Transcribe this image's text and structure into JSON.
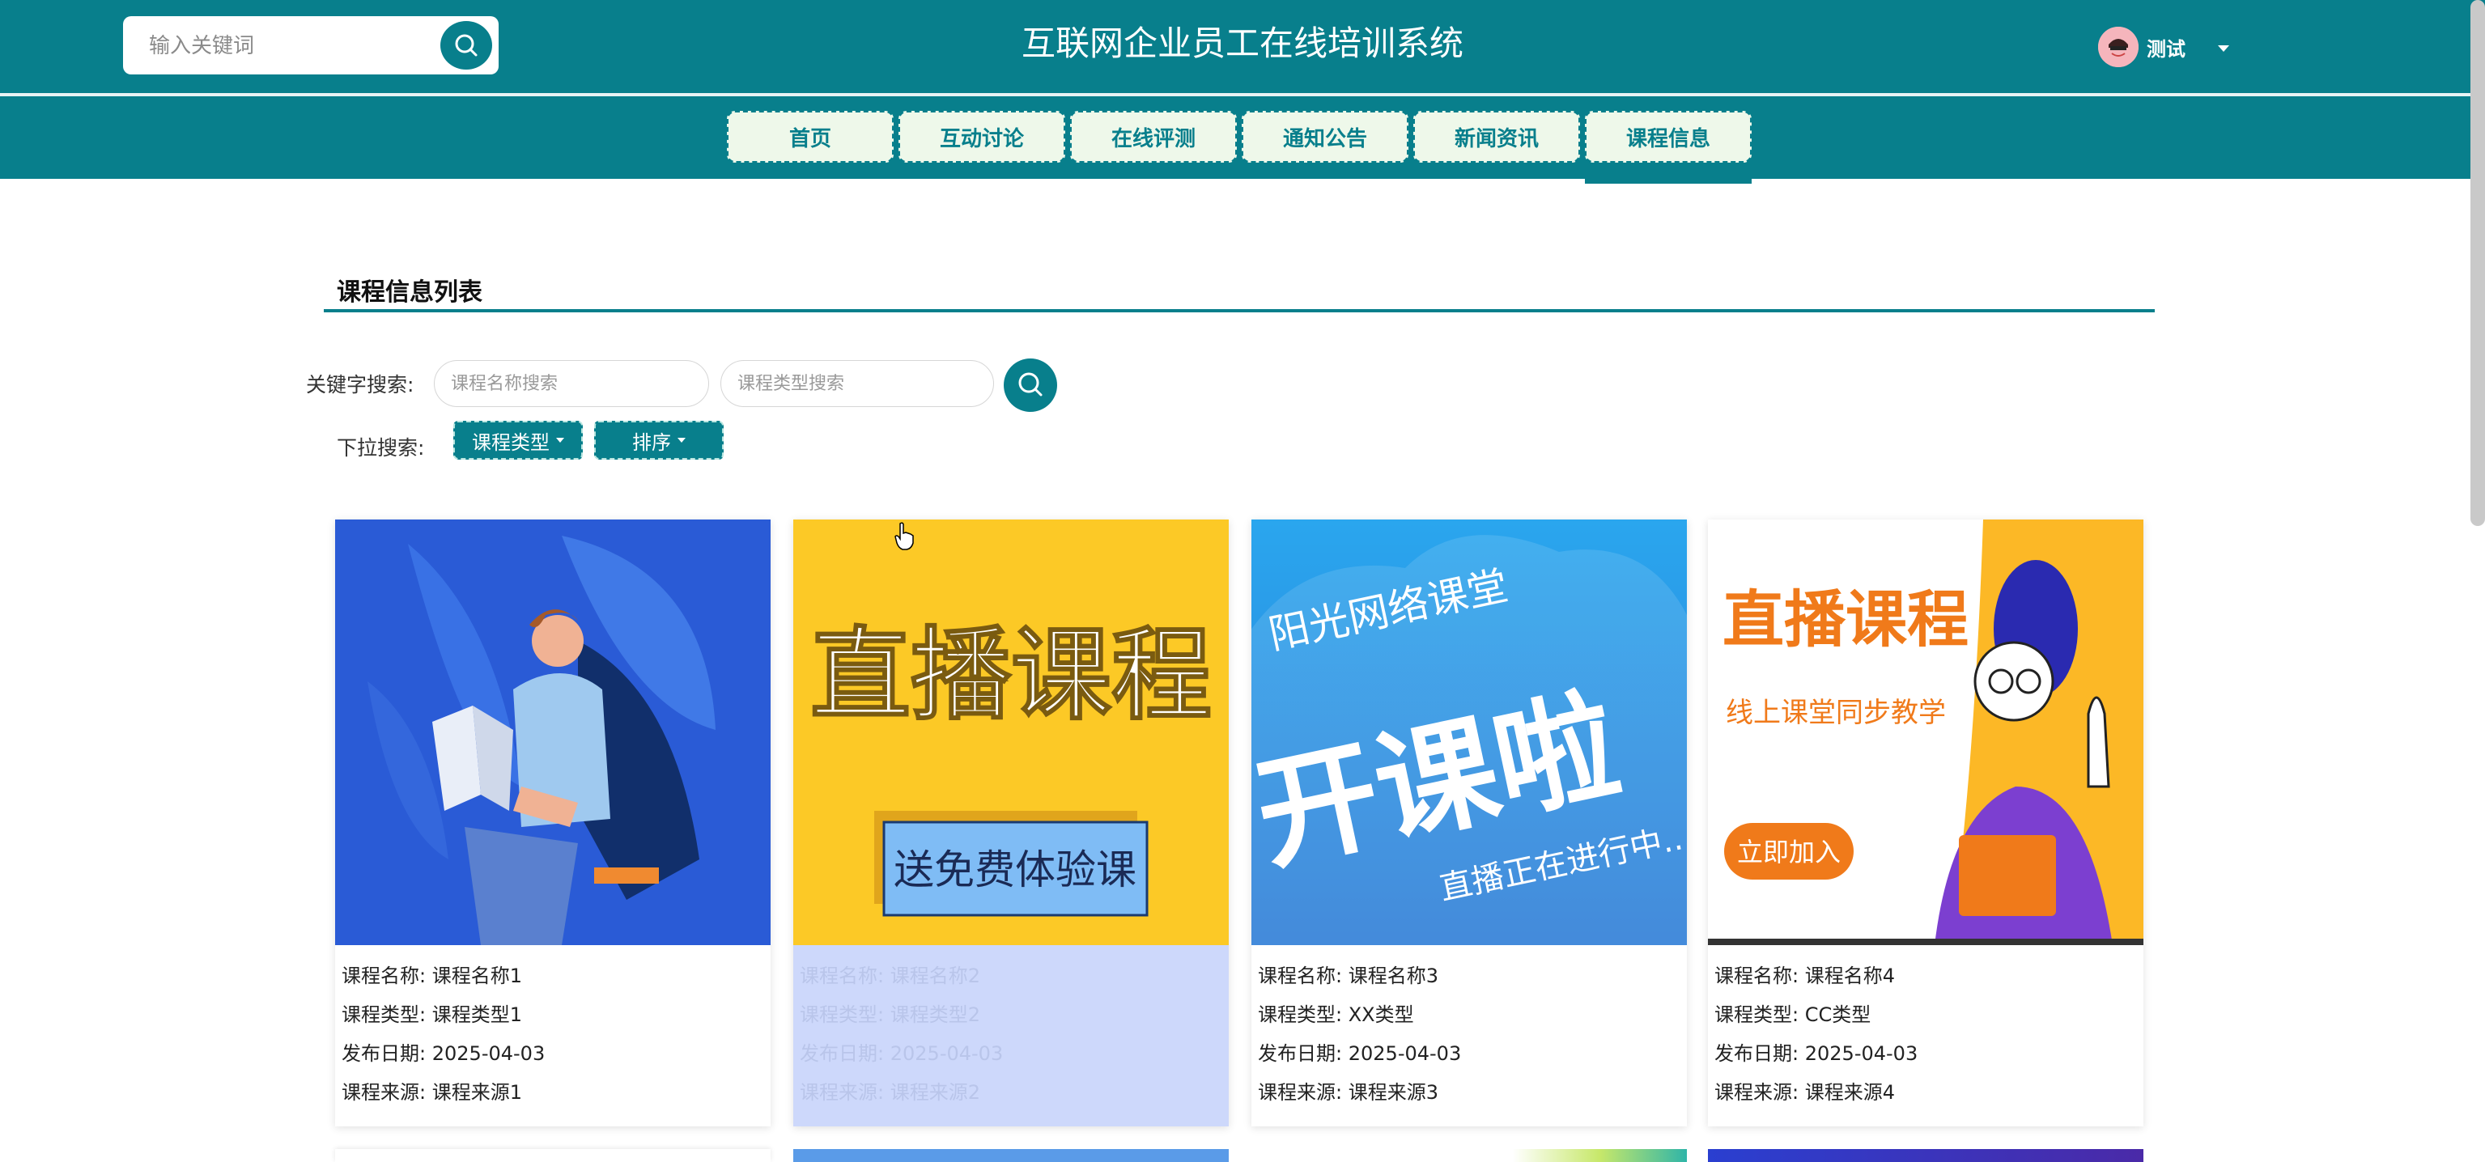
{
  "header": {
    "search_placeholder": "输入关键词",
    "site_title": "互联网企业员工在线培训系统",
    "user_name": "测试",
    "search_icon": "search-icon",
    "brand_color": "#087f8c"
  },
  "nav": {
    "items": [
      {
        "label": "首页"
      },
      {
        "label": "互动讨论"
      },
      {
        "label": "在线评测"
      },
      {
        "label": "通知公告"
      },
      {
        "label": "新闻资讯"
      },
      {
        "label": "课程信息"
      }
    ],
    "active": "课程信息"
  },
  "section": {
    "title": "课程信息列表",
    "keyword_label": "关键字搜索:",
    "name_placeholder": "课程名称搜索",
    "type_placeholder": "课程类型搜索",
    "dropdown_label": "下拉搜索:",
    "type_dropdown": "课程类型",
    "sort_dropdown": "排序"
  },
  "cards": [
    {
      "image_text": {},
      "name_label": "课程名称:",
      "name": "课程名称1",
      "type_label": "课程类型:",
      "type": "课程类型1",
      "date_label": "发布日期:",
      "date": "2025-04-03",
      "source_label": "课程来源:",
      "source": "课程来源1"
    },
    {
      "image_text": {
        "headline": "直播课程",
        "badge": "送免费体验课"
      },
      "name_label": "课程名称:",
      "name": "课程名称2",
      "type_label": "课程类型:",
      "type": "课程类型2",
      "date_label": "发布日期:",
      "date": "2025-04-03",
      "source_label": "课程来源:",
      "source": "课程来源2"
    },
    {
      "image_text": {
        "top": "阳光网络课堂",
        "big": "开课啦",
        "sub": "直播正在进行中..."
      },
      "name_label": "课程名称:",
      "name": "课程名称3",
      "type_label": "课程类型:",
      "type": "XX类型",
      "date_label": "发布日期:",
      "date": "2025-04-03",
      "source_label": "课程来源:",
      "source": "课程来源3"
    },
    {
      "image_text": {
        "headline": "直播课程",
        "sub": "线上课堂同步教学",
        "button": "立即加入"
      },
      "name_label": "课程名称:",
      "name": "课程名称4",
      "type_label": "课程类型:",
      "type": "CC类型",
      "date_label": "发布日期:",
      "date": "2025-04-03",
      "source_label": "课程来源:",
      "source": "课程来源4"
    }
  ]
}
